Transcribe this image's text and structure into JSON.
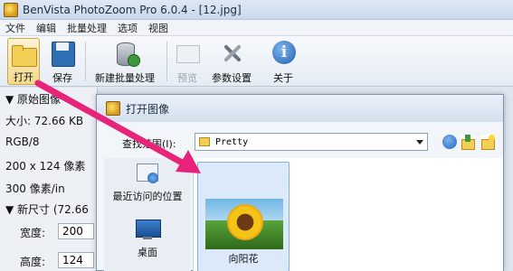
{
  "window": {
    "title": "BenVista PhotoZoom Pro 6.0.4 - [12.jpg]"
  },
  "menu": {
    "items": [
      "文件",
      "编辑",
      "批量处理",
      "选项",
      "视图"
    ]
  },
  "toolbar": {
    "open_label": "打开",
    "save_label": "保存",
    "batch_label": "新建批量处理",
    "preview_label": "预览",
    "params_label": "参数设置",
    "about_label": "关于"
  },
  "left_panel": {
    "original_header": "▼ 原始图像",
    "size": "大小: 72.66 KB",
    "color_mode": "RGB/8",
    "dimensions": "200 x 124 像素",
    "resolution": "300 像素/in",
    "new_size_header": "▼ 新尺寸 (72.66",
    "width_label": "宽度:",
    "width_value": "200",
    "height_label": "高度:",
    "height_value": "124"
  },
  "dialog": {
    "title": "打开图像",
    "lookin_label": "查找范围(I):",
    "lookin_value": "Pretty",
    "places": [
      {
        "label": "最近访问的位置",
        "icon": "recent-places-icon"
      },
      {
        "label": "桌面",
        "icon": "desktop-icon"
      }
    ],
    "files": [
      {
        "name": "向阳花"
      }
    ]
  },
  "colors": {
    "annotation_arrow": "#e8237a",
    "selection": "#dbe9f9"
  }
}
